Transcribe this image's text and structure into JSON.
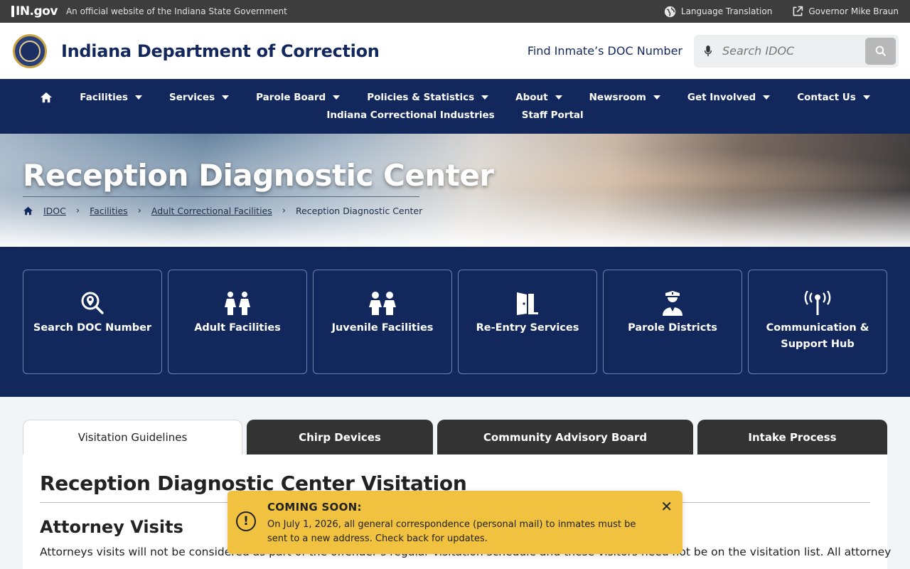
{
  "topbar": {
    "logo_text": "IN.gov",
    "official_text": "An official website of the Indiana State Government",
    "language_label": "Language Translation",
    "governor_label": "Governor Mike Braun"
  },
  "header": {
    "title": "Indiana Department of Correction",
    "find_link": "Find Inmate’s DOC Number",
    "search_placeholder": "Search IDOC"
  },
  "nav": {
    "row1": [
      "Facilities",
      "Services",
      "Parole Board",
      "Policies & Statistics",
      "About",
      "Newsroom",
      "Get Involved",
      "Contact Us"
    ],
    "row2": [
      "Indiana Correctional Industries",
      "Staff Portal"
    ]
  },
  "hero": {
    "title": "Reception Diagnostic Center",
    "breadcrumb": [
      "IDOC",
      "Facilities",
      "Adult Correctional Facilities",
      "Reception Diagnostic Center"
    ]
  },
  "quick_links": [
    {
      "label": "Search DOC Number",
      "icon": "search-location-icon"
    },
    {
      "label": "Adult Facilities",
      "icon": "adults-icon"
    },
    {
      "label": "Juvenile Facilities",
      "icon": "children-icon"
    },
    {
      "label": "Re-Entry Services",
      "icon": "door-open-icon"
    },
    {
      "label": "Parole Districts",
      "icon": "officer-icon"
    },
    {
      "label": "Communication & Support Hub",
      "icon": "broadcast-tower-icon"
    }
  ],
  "tabs": [
    "Visitation Guidelines",
    "Chirp Devices",
    "Community Advisory Board",
    "Intake Process"
  ],
  "content": {
    "heading": "Reception Diagnostic Center Visitation",
    "subheading": "Attorney Visits",
    "paragraph": "Attorneys visits will not be considered as part of the offender’s regular visitation schedule and these visitors need not be on the visitation list. All attorney"
  },
  "alert": {
    "title": "COMING SOON:",
    "body": "On July 1, 2026, all general correspondence (personal mail) to inmates must be sent to a new address. Check back for updates."
  },
  "colors": {
    "navy": "#12285d",
    "alert_yellow": "#f0c23f",
    "topbar": "#3d3d3d"
  }
}
